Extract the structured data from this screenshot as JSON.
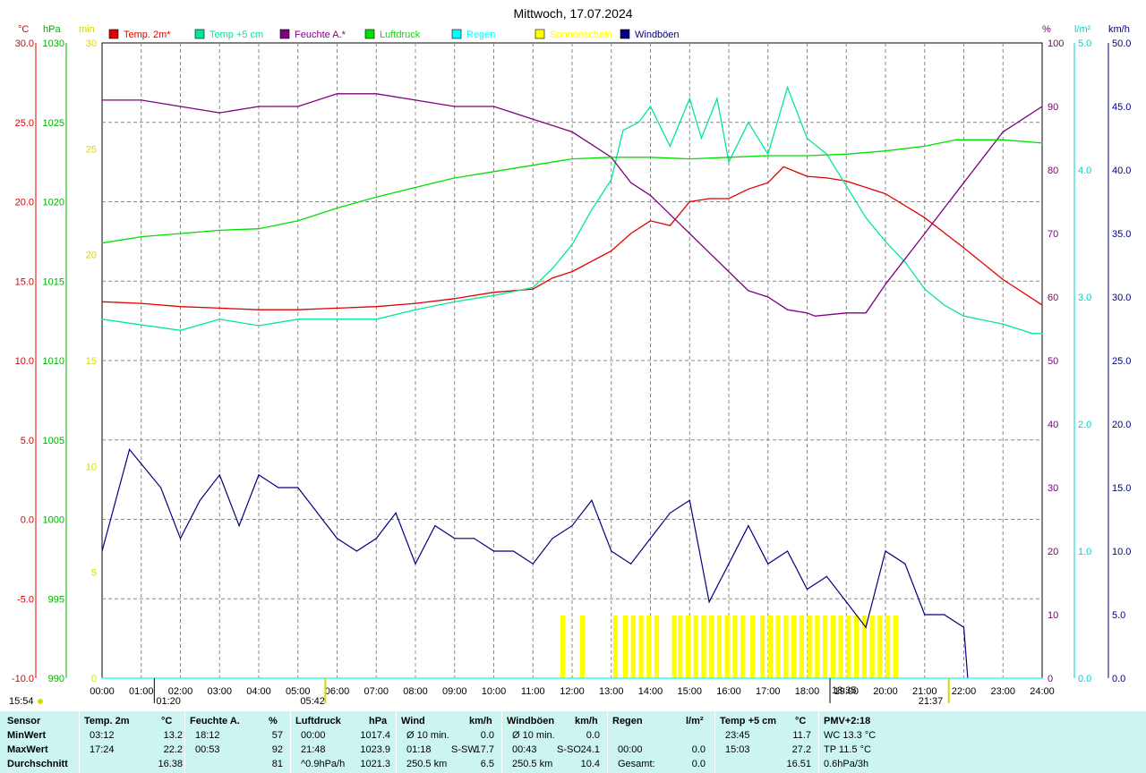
{
  "title": "Mittwoch, 17.07.2024",
  "legend": [
    {
      "label": "Temp. 2m*",
      "color": "#e00000"
    },
    {
      "label": "Temp +5 cm",
      "color": "#00e890"
    },
    {
      "label": "Feuchte A.*",
      "color": "#800080"
    },
    {
      "label": "Luftdruck",
      "color": "#00e000"
    },
    {
      "label": "Regen",
      "color": "#00ffff"
    },
    {
      "label": "Sonnenschein",
      "color": "#ffff00"
    },
    {
      "label": "Windböen",
      "color": "#000080"
    }
  ],
  "axes": {
    "temp_unit": "°C",
    "hpa_unit": "hPa",
    "min_unit": "min",
    "pct_unit": "%",
    "rain_unit": "l/m²",
    "wind_unit": "km/h",
    "temp_ticks": [
      "30.0",
      "25.0",
      "20.0",
      "15.0",
      "10.0",
      "5.0",
      "0.0",
      "-5.0",
      "-10.0"
    ],
    "hpa_ticks": [
      "1030",
      "1025",
      "1020",
      "1015",
      "1010",
      "1005",
      "1000",
      "995",
      "990"
    ],
    "min_ticks": [
      "30",
      "25",
      "20",
      "15",
      "10",
      "5",
      "0"
    ],
    "pct_ticks": [
      "100",
      "90",
      "80",
      "70",
      "60",
      "50",
      "40",
      "30",
      "20",
      "10",
      "0"
    ],
    "rain_ticks": [
      "5.0",
      "4.0",
      "3.0",
      "2.0",
      "1.0",
      "0.0"
    ],
    "wind_ticks": [
      "50.0",
      "45.0",
      "40.0",
      "35.0",
      "30.0",
      "25.0",
      "20.0",
      "15.0",
      "10.0",
      "5.0",
      "0.0"
    ],
    "time_ticks": [
      "00:00",
      "01:00",
      "02:00",
      "03:00",
      "04:00",
      "05:00",
      "06:00",
      "07:00",
      "08:00",
      "09:00",
      "10:00",
      "11:00",
      "12:00",
      "13:00",
      "14:00",
      "15:00",
      "16:00",
      "17:00",
      "18:00",
      "19:00",
      "20:00",
      "21:00",
      "22:00",
      "23:00",
      "24:00"
    ]
  },
  "markers": {
    "moonset": "01:20",
    "sunrise": "05:42",
    "sunset": "18:35",
    "moonrise": "21:37",
    "left_time": "15:54"
  },
  "chart_data": {
    "type": "line",
    "x_unit": "hours",
    "xlim": [
      0,
      24
    ],
    "series": [
      {
        "name": "Temp. 2m*",
        "axis": "°C",
        "x": [
          0,
          1,
          2,
          3,
          4,
          5,
          6,
          7,
          8,
          9,
          10,
          11,
          11.5,
          12,
          13,
          13.5,
          14,
          14.5,
          15,
          15.5,
          16,
          16.5,
          17,
          17.4,
          18,
          18.5,
          19,
          20,
          21,
          22,
          23,
          24
        ],
        "values": [
          13.7,
          13.6,
          13.4,
          13.3,
          13.2,
          13.2,
          13.3,
          13.4,
          13.6,
          13.9,
          14.3,
          14.5,
          15.2,
          15.6,
          16.9,
          18.0,
          18.8,
          18.5,
          20.0,
          20.2,
          20.2,
          20.8,
          21.2,
          22.2,
          21.6,
          21.5,
          21.3,
          20.5,
          19.0,
          17.1,
          15.1,
          13.5
        ]
      },
      {
        "name": "Temp +5 cm",
        "axis": "°C",
        "x": [
          0,
          2,
          3,
          4,
          5,
          6,
          7,
          8,
          9,
          10,
          11,
          11.5,
          12,
          12.5,
          13,
          13.3,
          13.7,
          14,
          14.5,
          15,
          15.3,
          15.7,
          16,
          16.5,
          17,
          17.5,
          18,
          18.5,
          19,
          19.5,
          20,
          20.5,
          21,
          21.5,
          22,
          23,
          23.75,
          24
        ],
        "values": [
          12.6,
          11.9,
          12.6,
          12.2,
          12.6,
          12.6,
          12.6,
          13.2,
          13.7,
          14.1,
          14.6,
          15.8,
          17.3,
          19.5,
          21.4,
          24.5,
          25.0,
          26.0,
          23.5,
          26.5,
          24.0,
          26.5,
          22.5,
          25.0,
          23.0,
          27.2,
          24.0,
          23.0,
          21.0,
          19.0,
          17.5,
          16.2,
          14.5,
          13.5,
          12.8,
          12.3,
          11.7,
          11.7
        ]
      },
      {
        "name": "Feuchte A.*",
        "axis": "%",
        "x": [
          0,
          1,
          2,
          3,
          4,
          5,
          6,
          7,
          8,
          9,
          10,
          11,
          11.5,
          12,
          12.5,
          13,
          13.5,
          14,
          14.5,
          15,
          15.5,
          16,
          16.5,
          17,
          17.5,
          18,
          18.2,
          19,
          19.5,
          20,
          21,
          22,
          23,
          24
        ],
        "values": [
          91,
          91,
          90,
          89,
          90,
          90,
          92,
          92,
          91,
          90,
          90,
          88,
          87,
          86,
          84,
          82,
          78,
          76,
          73,
          70,
          67,
          64,
          61,
          60,
          58,
          57.5,
          57,
          57.5,
          57.5,
          62,
          70,
          78,
          86,
          90
        ]
      },
      {
        "name": "Luftdruck",
        "axis": "hPa",
        "x": [
          0,
          1,
          2,
          3,
          4,
          5,
          6,
          7,
          8,
          9,
          10,
          11,
          12,
          13,
          14,
          15,
          16,
          17,
          18,
          19,
          20,
          21,
          21.8,
          23,
          24
        ],
        "values": [
          1017.4,
          1017.8,
          1018.0,
          1018.2,
          1018.3,
          1018.8,
          1019.6,
          1020.3,
          1020.9,
          1021.5,
          1021.9,
          1022.3,
          1022.7,
          1022.8,
          1022.8,
          1022.7,
          1022.8,
          1022.9,
          1022.9,
          1023.0,
          1023.2,
          1023.5,
          1023.9,
          1023.9,
          1023.7
        ]
      },
      {
        "name": "Windböen",
        "axis": "km/h",
        "x": [
          0,
          0.7,
          1.5,
          2,
          2.5,
          3,
          3.5,
          4,
          4.5,
          5,
          5.5,
          6,
          6.5,
          7,
          7.5,
          8,
          8.5,
          9,
          9.5,
          10,
          10.5,
          11,
          11.5,
          12,
          12.5,
          13,
          13.5,
          14,
          14.5,
          15,
          15.5,
          16,
          16.5,
          17,
          17.5,
          18,
          18.5,
          19,
          19.5,
          20,
          20.5,
          21,
          21.5,
          22,
          22.1
        ],
        "values": [
          10,
          18,
          15,
          11,
          14,
          16,
          12,
          16,
          15,
          15,
          13,
          11,
          10,
          11,
          13,
          9,
          12,
          11,
          11,
          10,
          10,
          9,
          11,
          12,
          14,
          10,
          9,
          11,
          13,
          14,
          6,
          9,
          12,
          9,
          10,
          7,
          8,
          6,
          4,
          10,
          9,
          5,
          5,
          4,
          0
        ]
      },
      {
        "name": "Sonnenschein",
        "axis": "min",
        "type": "bar",
        "x": [
          11.7,
          12.2,
          13.05,
          13.3,
          13.5,
          13.7,
          13.9,
          14.1,
          14.55,
          14.7,
          14.9,
          15.1,
          15.3,
          15.5,
          15.7,
          15.9,
          16.1,
          16.3,
          16.55,
          16.8,
          17.0,
          17.2,
          17.4,
          17.6,
          17.8,
          18.0,
          18.2,
          18.4,
          18.6,
          18.8,
          19.0,
          19.2,
          19.4,
          19.6,
          19.8,
          20.0,
          20.2
        ],
        "values": [
          1,
          1,
          1,
          1,
          1,
          1,
          1,
          1,
          1,
          1,
          1,
          1,
          1,
          1,
          1,
          1,
          1,
          1,
          1,
          1,
          1,
          1,
          1,
          1,
          1,
          1,
          1,
          1,
          1,
          1,
          1,
          1,
          1,
          1,
          1,
          1,
          1
        ]
      },
      {
        "name": "Regen",
        "axis": "l/m²",
        "x": [
          0,
          24
        ],
        "values": [
          0,
          0
        ]
      }
    ]
  },
  "stats": {
    "sensor": {
      "h": "Sensor",
      "min": "MinWert",
      "max": "MaxWert",
      "avg": "Durchschnitt"
    },
    "temp2m": {
      "h": "Temp. 2m",
      "u": "°C",
      "min_t": "03:12",
      "min_v": "13.2",
      "max_t": "17:24",
      "max_v": "22.2",
      "avg_v": "16.38"
    },
    "feuchte": {
      "h": "Feuchte A.",
      "u": "%",
      "min_t": "18:12",
      "min_v": "57",
      "max_t": "00:53",
      "max_v": "92",
      "avg_v": "81"
    },
    "luftdruck": {
      "h": "Luftdruck",
      "u": "hPa",
      "min_t": "00:00",
      "min_v": "1017.4",
      "max_t": "21:48",
      "max_v": "1023.9",
      "avg_t": "^0.9hPa/h",
      "avg_v": "1021.3"
    },
    "wind": {
      "h": "Wind",
      "u": "km/h",
      "min_t": "Ø 10 min.",
      "min_v": "0.0",
      "max_t": "01:18",
      "max_d": "S-SW",
      "max_v": "17.7",
      "avg_t": "250.5 km",
      "avg_v": "6.5"
    },
    "windboeen": {
      "h": "Windböen",
      "u": "km/h",
      "min_t": "Ø 10 min.",
      "min_v": "0.0",
      "max_t": "00:43",
      "max_d": "S-SO",
      "max_v": "24.1",
      "avg_t": "250.5 km",
      "avg_v": "10.4"
    },
    "regen": {
      "h": "Regen",
      "u": "l/m²",
      "max_t": "00:00",
      "max_v": "0.0",
      "avg_t": "Gesamt:",
      "avg_v": "0.0"
    },
    "temp5": {
      "h": "Temp +5 cm",
      "u": "°C",
      "min_t": "23:45",
      "min_v": "11.7",
      "max_t": "15:03",
      "max_v": "27.2",
      "avg_v": "16.51"
    },
    "pmv": {
      "h": "PMV+2:18",
      "l1": "WC 13.3 °C",
      "l2": "TP 11.5 °C",
      "l3": "0.6hPa/3h"
    }
  }
}
